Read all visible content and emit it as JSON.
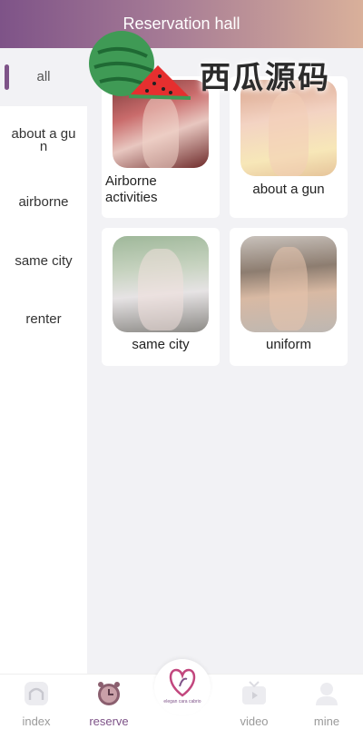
{
  "header": {
    "title": "Reservation hall"
  },
  "watermark": {
    "text": "西瓜源码"
  },
  "sidebar": {
    "items": [
      {
        "label": "all",
        "active": true
      },
      {
        "label": "about a gun"
      },
      {
        "label": "airborne"
      },
      {
        "label": "same city"
      },
      {
        "label": "renter"
      }
    ]
  },
  "cards": [
    {
      "caption": "Airborne activities"
    },
    {
      "caption": "about a gun"
    },
    {
      "caption": "same city"
    },
    {
      "caption": "uniform"
    }
  ],
  "nav": {
    "items": [
      {
        "label": "index",
        "icon": "home-icon"
      },
      {
        "label": "reserve",
        "icon": "clock-icon",
        "active": true
      },
      {
        "label": "video",
        "icon": "tv-icon"
      },
      {
        "label": "mine",
        "icon": "user-icon"
      }
    ],
    "brand": "elegan cara cabrio"
  },
  "colors": {
    "accent": "#7e5388",
    "background": "#f2f2f5"
  }
}
